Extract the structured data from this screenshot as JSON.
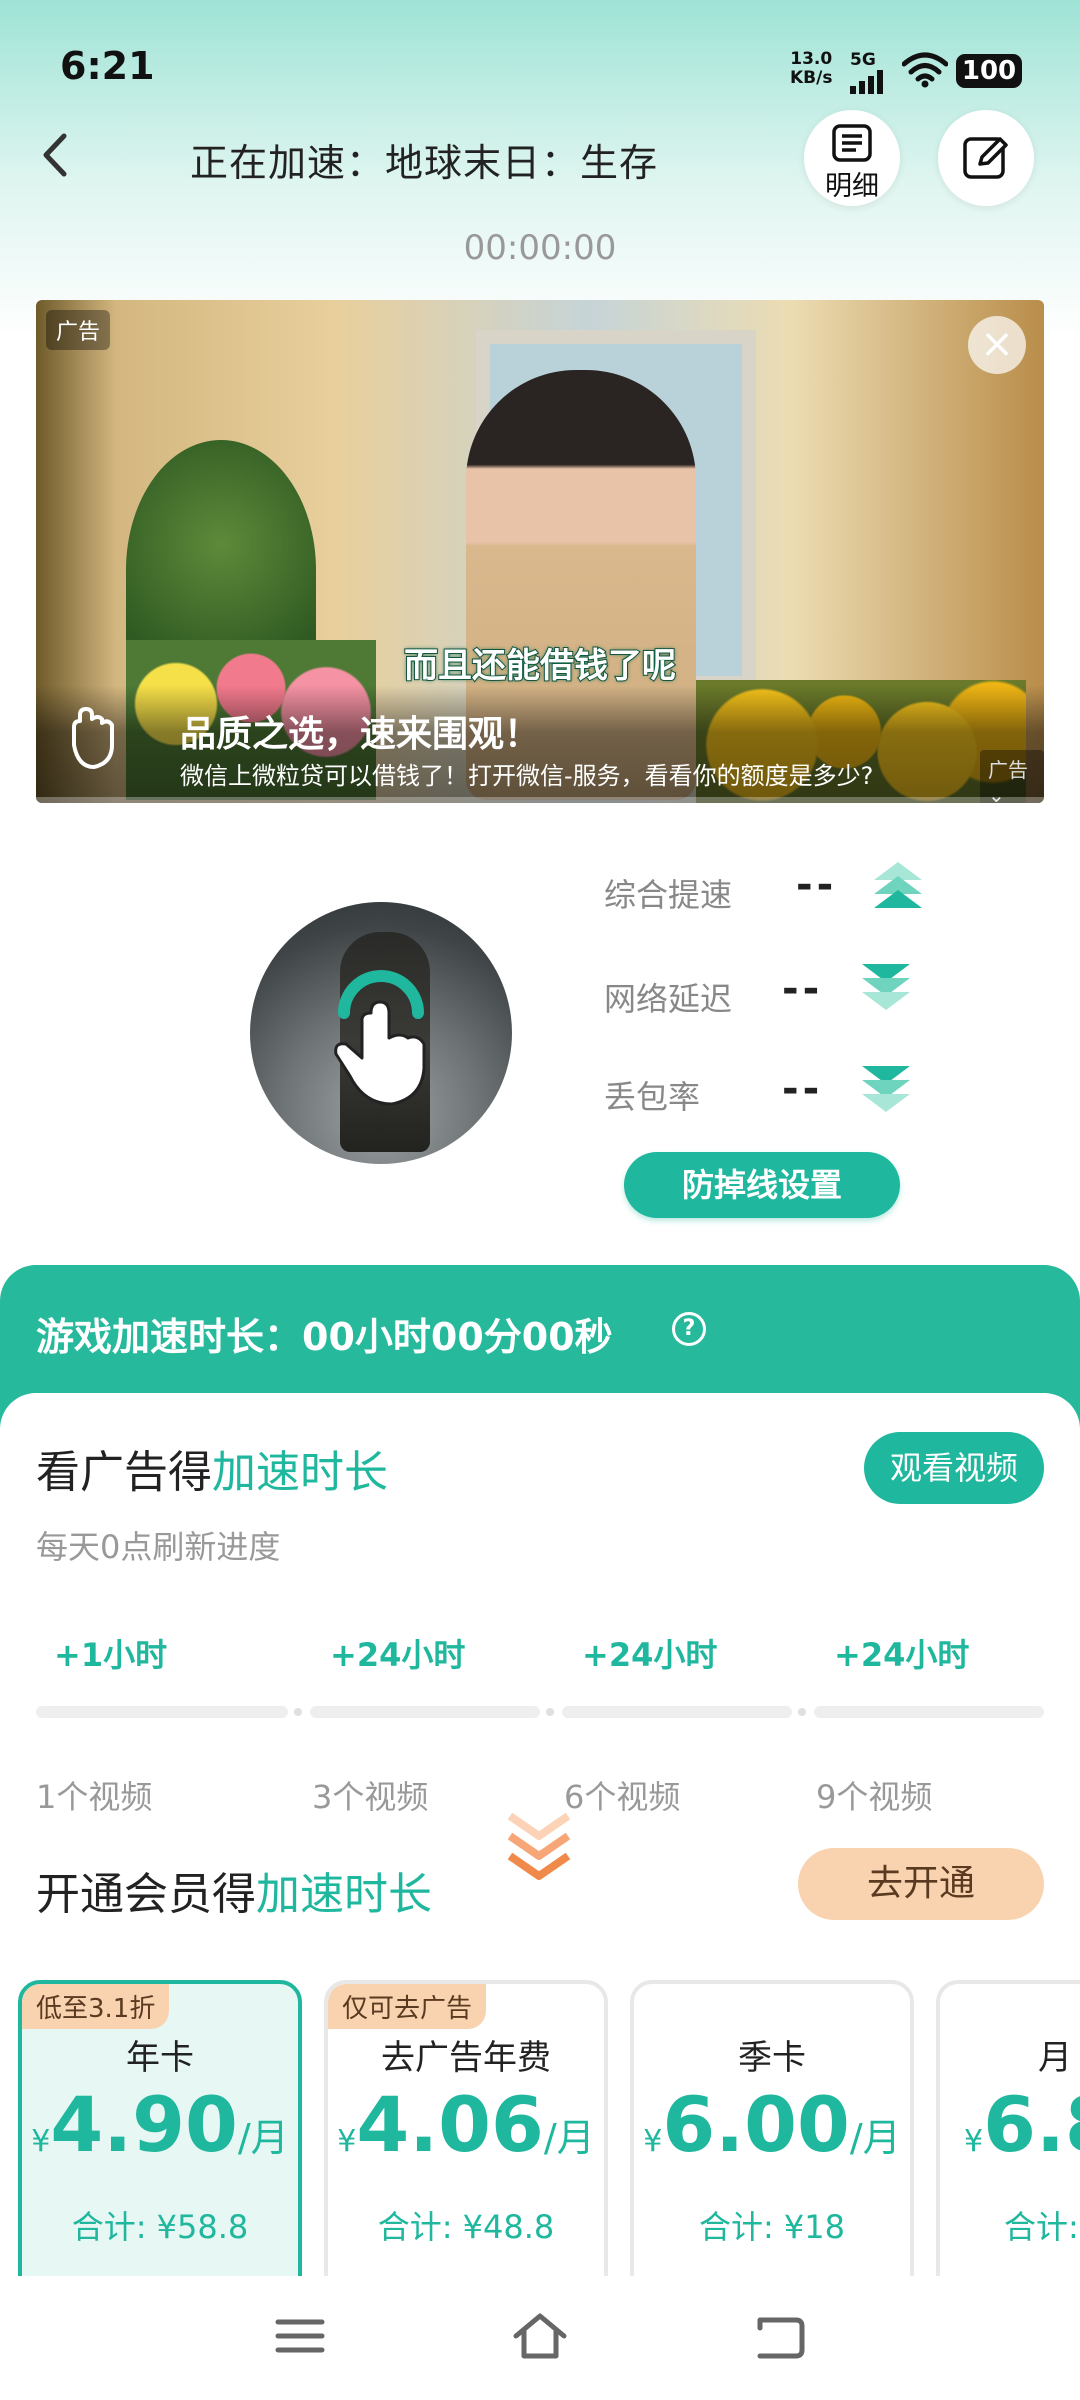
{
  "status_bar": {
    "time": "6:21",
    "net_speed_value": "13.0",
    "net_speed_unit": "KB/s",
    "network": "5G",
    "battery": "100"
  },
  "header": {
    "title": "正在加速：地球末日：生存",
    "detail_label": "明细",
    "timer": "00:00:00"
  },
  "ad": {
    "tag": "广告",
    "subtitle": "而且还能借钱了呢",
    "headline": "品质之选，速来围观！",
    "description": "微信上微粒贷可以借钱了！打开微信-服务，看看你的额度是多少?",
    "more_label": "广告"
  },
  "stats": [
    {
      "label": "综合提速",
      "value": "--",
      "arrow": "up-arrows-icon"
    },
    {
      "label": "网络延迟",
      "value": "--",
      "arrow": "down-arrows-icon"
    },
    {
      "label": "丢包率",
      "value": "--",
      "arrow": "down-arrows-icon"
    }
  ],
  "anti_drop_button": "防掉线设置",
  "duration_band": {
    "text": "游戏加速时长：00小时00分00秒",
    "help_icon": "?"
  },
  "ad_reward": {
    "title_prefix": "看广告得",
    "title_accent": "加速时长",
    "watch_button": "观看视频",
    "refresh_note": "每天0点刷新进度",
    "rewards": [
      "+1小时",
      "+24小时",
      "+24小时",
      "+24小时"
    ],
    "video_counts": [
      "1个视频",
      "3个视频",
      "6个视频",
      "9个视频"
    ],
    "progress": 0
  },
  "membership": {
    "title_prefix": "开通会员得",
    "title_accent": "加速时长",
    "open_button": "去开通",
    "plans": [
      {
        "badge": "低至3.1折",
        "name": "年卡",
        "yen": "¥",
        "price": "4.90",
        "unit": "/月",
        "total": "合计: ¥58.8"
      },
      {
        "badge": "仅可去广告",
        "name": "去广告年费",
        "yen": "¥",
        "price": "4.06",
        "unit": "/月",
        "total": "合计: ¥48.8"
      },
      {
        "badge": "",
        "name": "季卡",
        "yen": "¥",
        "price": "6.00",
        "unit": "/月",
        "total": "合计: ¥18"
      },
      {
        "badge": "",
        "name": "月",
        "yen": "¥",
        "price": "6.8",
        "unit": "",
        "total": "合计:"
      }
    ]
  },
  "colors": {
    "accent": "#1fb79d",
    "band": "#27b99c",
    "peach": "#f9d3b0"
  }
}
